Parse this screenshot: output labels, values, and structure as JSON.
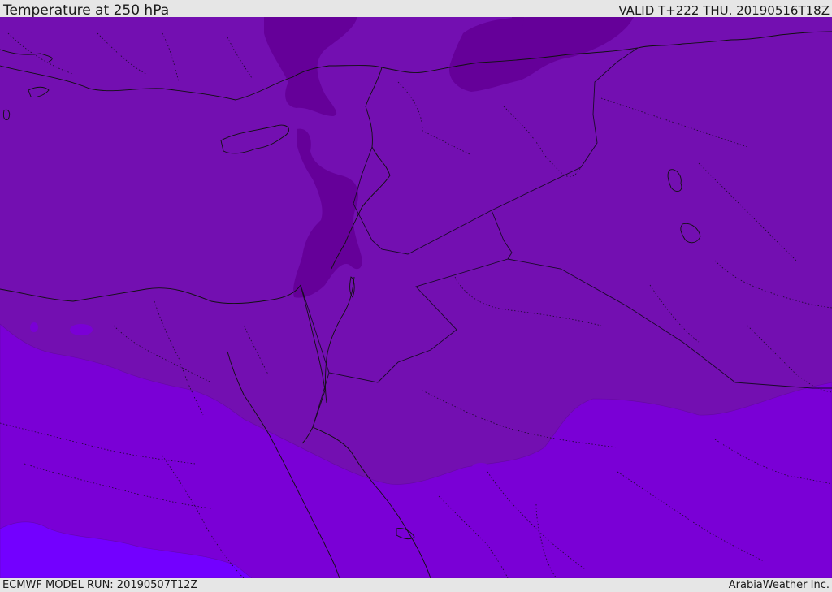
{
  "header": {
    "title": "Temperature at 250 hPa",
    "valid": "VALID T+222 THU. 20190516T18Z"
  },
  "footer": {
    "model_run": "ECMWF MODEL RUN: 20190507T12Z",
    "credit": "ArabiaWeather Inc."
  },
  "map": {
    "fill_colors": {
      "cold_core": "#650099",
      "base": "#730fb1",
      "mid": "#7a00d6",
      "warm": "#7300ff"
    },
    "line_colors": {
      "coast": "#111111",
      "border": "#1a0a2a"
    }
  }
}
